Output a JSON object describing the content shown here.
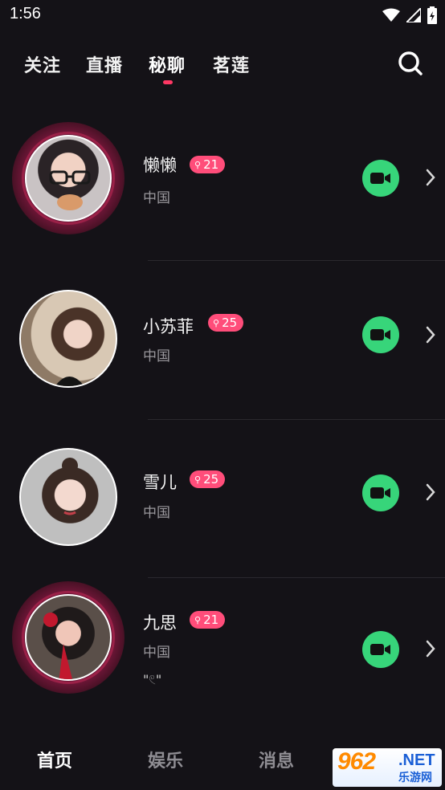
{
  "status_bar": {
    "time": "1:56"
  },
  "top_nav": {
    "tabs": [
      {
        "label": "关注"
      },
      {
        "label": "直播"
      },
      {
        "label": "秘聊",
        "active": true
      },
      {
        "label": "茗莲"
      }
    ]
  },
  "colors": {
    "background": "#141217",
    "accent": "#ff3864",
    "badge": "#ff4d7a",
    "video_button": "#37d57a",
    "live_ring": "#9b2148"
  },
  "users": [
    {
      "name": "懒懒",
      "age": "21",
      "location": "中国",
      "live": true,
      "extra": ""
    },
    {
      "name": "小苏菲",
      "age": "25",
      "location": "中国",
      "live": false,
      "extra": ""
    },
    {
      "name": "雪儿",
      "age": "25",
      "location": "中国",
      "live": false,
      "extra": ""
    },
    {
      "name": "九思",
      "age": "21",
      "location": "中国",
      "live": true,
      "extra": "\"𓏲\""
    }
  ],
  "bottom_nav": {
    "items": [
      {
        "label": "首页",
        "active": true
      },
      {
        "label": "娱乐"
      },
      {
        "label": "消息"
      }
    ]
  },
  "watermark": {
    "brand": "962",
    "domain": ".NET",
    "sub": "乐游网"
  },
  "icons": {
    "search": "search-icon",
    "video": "video-camera-icon",
    "chevron": "chevron-right-icon",
    "gender": "gender-icon"
  }
}
